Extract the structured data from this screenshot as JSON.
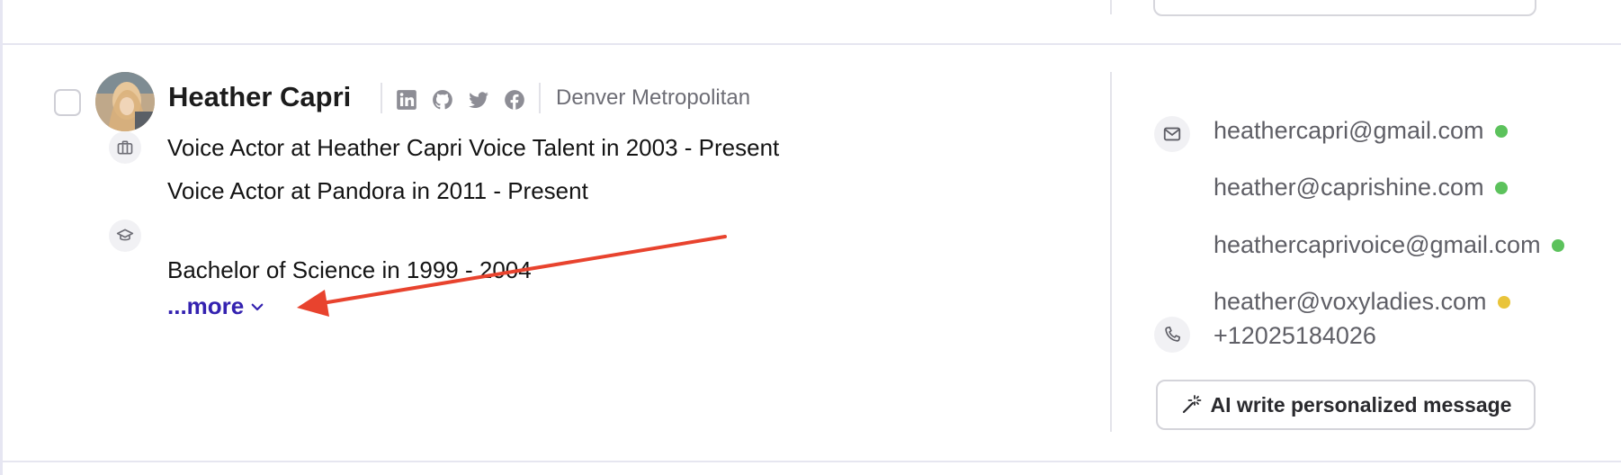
{
  "profile": {
    "name": "Heather Capri",
    "location": "Denver Metropolitan",
    "socials": [
      "linkedin-icon",
      "github-icon",
      "twitter-icon",
      "facebook-icon"
    ]
  },
  "experience": [
    "Voice Actor at Heather Capri Voice Talent in 2003 - Present",
    "Voice Actor at Pandora in 2011 - Present"
  ],
  "education": [
    "Bachelor of Science in 1999 - 2004"
  ],
  "more_label": "...more",
  "contacts": {
    "emails": [
      {
        "address": "heathercapri@gmail.com",
        "status_color": "#5cc25c"
      },
      {
        "address": "heather@caprishine.com",
        "status_color": "#5cc25c"
      },
      {
        "address": "heathercaprivoice@gmail.com",
        "status_color": "#5cc25c"
      },
      {
        "address": "heather@voxyladies.com",
        "status_color": "#e9c43a"
      }
    ],
    "phone": "+12025184026"
  },
  "ai_button_label": "AI write personalized message",
  "colors": {
    "accent_link": "#3422b0",
    "annotation_arrow": "#e8432e"
  }
}
